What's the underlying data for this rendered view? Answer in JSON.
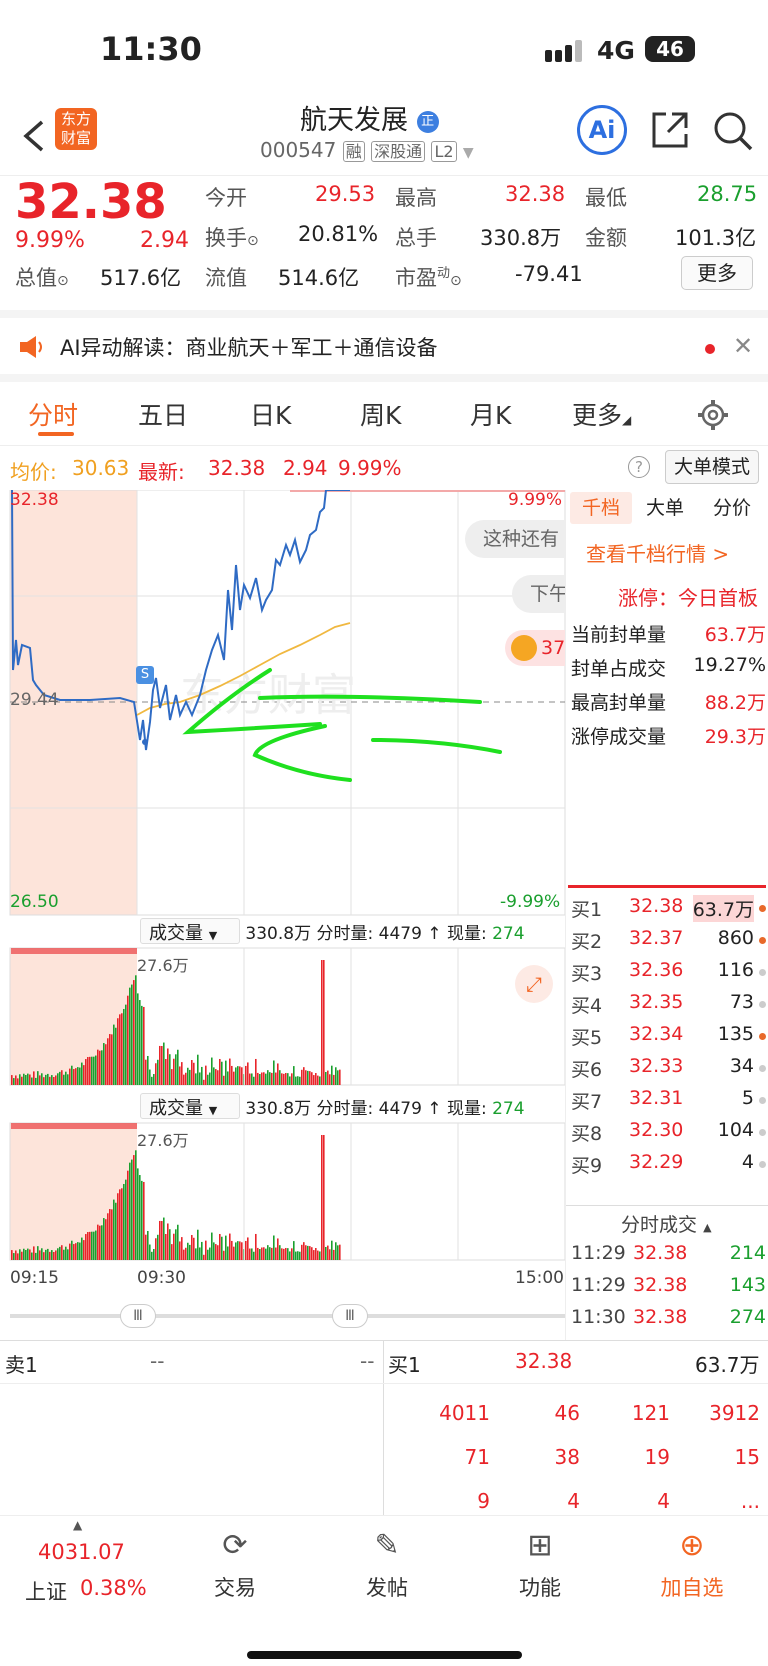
{
  "status": {
    "time": "11:30",
    "network": "4G",
    "battery": "46"
  },
  "nav": {
    "logo_line1": "东方",
    "logo_line2": "财富",
    "title": "航天发展",
    "code": "000547",
    "badges": [
      "融",
      "深股通",
      "L2"
    ],
    "ai_label": "Ai"
  },
  "quote": {
    "price": "32.38",
    "pct": "9.99%",
    "chg": "2.94",
    "fields": [
      {
        "label": "今开",
        "value": "29.53",
        "color": "red"
      },
      {
        "label": "最高",
        "value": "32.38",
        "color": "red"
      },
      {
        "label": "最低",
        "value": "28.75",
        "color": "green"
      },
      {
        "label": "换手",
        "value": "20.81%",
        "color": "dark"
      },
      {
        "label": "总手",
        "value": "330.8万",
        "color": "dark"
      },
      {
        "label": "金额",
        "value": "101.3亿",
        "color": "dark"
      },
      {
        "label": "总值",
        "value": "517.6亿",
        "color": "dark"
      },
      {
        "label": "流值",
        "value": "514.6亿",
        "color": "dark"
      },
      {
        "label": "市盈",
        "label_sup": "动",
        "value": "-79.41",
        "color": "dark"
      }
    ],
    "more": "更多"
  },
  "ai_bar": {
    "text": "AI异动解读：商业航天＋军工＋通信设备"
  },
  "tabs": [
    "分时",
    "五日",
    "日K",
    "周K",
    "月K",
    "更多"
  ],
  "avg_line": {
    "avg_label": "均价:",
    "avg_value": "30.63",
    "latest_label": "最新:",
    "latest_value": "32.38",
    "chg": "2.94",
    "pct": "9.99%",
    "mode_btn": "大单模式"
  },
  "chart": {
    "y_max": "32.38",
    "y_mid": "29.44",
    "y_min": "26.50",
    "pct_max": "9.99%",
    "pct_min": "-9.99%",
    "bubble1": "这种还有",
    "bubble2": "下午",
    "bubble3": "37",
    "watermark": "东方财富",
    "marker": "S",
    "vol_label": "成交量",
    "vol_total": "330.8万",
    "vol_fs_label": "分时量:",
    "vol_fs": "4479",
    "vol_now_label": "现量:",
    "vol_now": "274",
    "vol_max": "27.6万",
    "time_start": "09:15",
    "time_mid": "09:30",
    "time_end": "15:00"
  },
  "right": {
    "tabs": [
      "千档",
      "大单",
      "分价"
    ],
    "view": "查看千档行情 >",
    "limit_label": "涨停：",
    "limit_value": "今日首板",
    "stats": [
      {
        "label": "当前封单量",
        "value": "63.7万"
      },
      {
        "label": "封单占成交",
        "value": "19.27%"
      },
      {
        "label": "最高封单量",
        "value": "88.2万"
      },
      {
        "label": "涨停成交量",
        "value": "29.3万"
      }
    ],
    "bids": [
      {
        "label": "买1",
        "price": "32.38",
        "vol": "63.7万",
        "dot": "#e8692a"
      },
      {
        "label": "买2",
        "price": "32.37",
        "vol": "860",
        "dot": "#e8692a"
      },
      {
        "label": "买3",
        "price": "32.36",
        "vol": "116",
        "dot": "#ccc"
      },
      {
        "label": "买4",
        "price": "32.35",
        "vol": "73",
        "dot": "#ccc"
      },
      {
        "label": "买5",
        "price": "32.34",
        "vol": "135",
        "dot": "#e8692a"
      },
      {
        "label": "买6",
        "price": "32.33",
        "vol": "34",
        "dot": "#ccc"
      },
      {
        "label": "买7",
        "price": "32.31",
        "vol": "5",
        "dot": "#ccc"
      },
      {
        "label": "买8",
        "price": "32.30",
        "vol": "104",
        "dot": "#ccc"
      },
      {
        "label": "买9",
        "price": "32.29",
        "vol": "4",
        "dot": "#ccc"
      }
    ],
    "trades_title": "分时成交",
    "trades": [
      {
        "time": "11:29",
        "price": "32.38",
        "vol": "214"
      },
      {
        "time": "11:29",
        "price": "32.38",
        "vol": "143"
      },
      {
        "time": "11:30",
        "price": "32.38",
        "vol": "274"
      }
    ]
  },
  "bottom": {
    "sell_label": "卖1",
    "sell_price": "--",
    "sell_vol": "--",
    "buy_label": "买1",
    "buy_price": "32.38",
    "buy_vol": "63.7万",
    "grid": [
      [
        "4011",
        "46",
        "121",
        "3912"
      ],
      [
        "71",
        "38",
        "19",
        "15"
      ],
      [
        "9",
        "4",
        "4",
        "..."
      ]
    ]
  },
  "footer": {
    "index_value": "4031.07",
    "index_name": "上证",
    "index_pct": "0.38%",
    "trade": "交易",
    "post": "发帖",
    "func": "功能",
    "add": "加自选"
  }
}
